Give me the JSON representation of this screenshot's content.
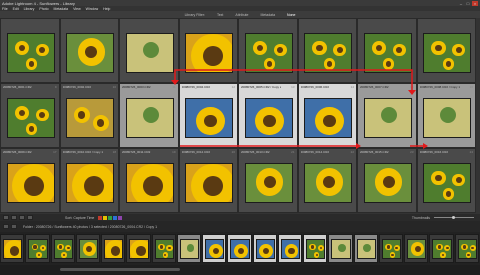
{
  "window": {
    "title": "Adobe Lightroom 4 - Sunflowers - Library",
    "menu": [
      "File",
      "Edit",
      "Library",
      "Photo",
      "Metadata",
      "View",
      "Window",
      "Help"
    ]
  },
  "filter_bar": {
    "items": [
      "Library Filter:",
      "Text",
      "Attribute",
      "Metadata",
      "None"
    ],
    "active": "None"
  },
  "grid": {
    "rows": [
      {
        "cells": [
          {
            "meta": "",
            "num": "",
            "state": "dark",
            "photo": "sunflower-field"
          },
          {
            "meta": "",
            "num": "",
            "state": "dark",
            "photo": "sunflower-single"
          },
          {
            "meta": "",
            "num": "",
            "state": "dark",
            "photo": "sunflower-bud"
          },
          {
            "meta": "",
            "num": "",
            "state": "dark",
            "photo": "sunflower-macro"
          },
          {
            "meta": "",
            "num": "",
            "state": "dark",
            "photo": "sunflower-field"
          },
          {
            "meta": "",
            "num": "",
            "state": "dark",
            "photo": "sunflower-field"
          },
          {
            "meta": "",
            "num": "",
            "state": "dark",
            "photo": "sunflower-field"
          },
          {
            "meta": "",
            "num": "",
            "state": "dark",
            "photo": "sunflower-field"
          }
        ]
      },
      {
        "cells": [
          {
            "meta": "20080726_0001.CR2",
            "num": "9",
            "state": "dark",
            "photo": "sunflower-field"
          },
          {
            "meta": "20080726_0002.CR2",
            "num": "10",
            "state": "dark",
            "photo": "sunflower-blur"
          },
          {
            "meta": "20080726_0003.CR2",
            "num": "11",
            "state": "sel",
            "photo": "sunflower-bud"
          },
          {
            "meta": "20080726_0004.CR2",
            "num": "12",
            "state": "bright",
            "photo": "sunflower-trio"
          },
          {
            "meta": "20080726_0005.CR2 / Copy 2",
            "num": "13",
            "state": "bright",
            "photo": "sunflower-trio"
          },
          {
            "meta": "20080726_0006.CR2",
            "num": "14",
            "state": "bright",
            "photo": "sunflower-trio"
          },
          {
            "meta": "20080726_0007.CR2",
            "num": "15",
            "state": "sel",
            "photo": "sunflower-bud"
          },
          {
            "meta": "20080726_0008.CR2 / Copy 1",
            "num": "16",
            "state": "sel",
            "photo": "sunflower-bud"
          }
        ]
      },
      {
        "cells": [
          {
            "meta": "20080726_0009.CR2",
            "num": "17",
            "state": "dark",
            "photo": "sunflower-macro"
          },
          {
            "meta": "20080726_0010.CR2 / Copy 1",
            "num": "18",
            "state": "dark",
            "photo": "sunflower-macro"
          },
          {
            "meta": "20080726_0011.CR2",
            "num": "19",
            "state": "dark",
            "photo": "sunflower-macro"
          },
          {
            "meta": "20080726_0012.CR2",
            "num": "20",
            "state": "dark",
            "photo": "sunflower-macro"
          },
          {
            "meta": "20080726_0013.CR2",
            "num": "21",
            "state": "dark",
            "photo": "sunflower-single"
          },
          {
            "meta": "20080726_0014.CR2",
            "num": "22",
            "state": "dark",
            "photo": "sunflower-single"
          },
          {
            "meta": "20080726_0015.CR2",
            "num": "23",
            "state": "dark",
            "photo": "sunflower-single"
          },
          {
            "meta": "20080726_0016.CR2",
            "num": "24",
            "state": "dark",
            "photo": "sunflower-field"
          }
        ]
      }
    ]
  },
  "toolbar": {
    "sort_label": "Sort: Capture Time",
    "thumbnails_label": "Thumbnails",
    "color_swatches": [
      "#c0392b",
      "#e6c200",
      "#2e9e44",
      "#2d6fd6",
      "#8e44ad"
    ]
  },
  "filmstrip_header": {
    "text": "Folder : 20080726 / Sunflowers  40 photos / 3 selected / 20080726_0004.CR2 / Copy 1"
  },
  "colors": {
    "arrow": "#e0191b",
    "panel_dark": "#2b2b2b",
    "cell_selected": "#d8d8d8"
  }
}
